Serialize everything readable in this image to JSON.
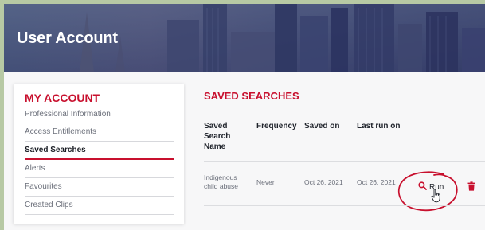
{
  "header": {
    "title": "User Account"
  },
  "sidebar": {
    "title": "MY ACCOUNT",
    "items": [
      {
        "label": "Professional Information",
        "active": false
      },
      {
        "label": "Access Entitlements",
        "active": false
      },
      {
        "label": "Saved Searches",
        "active": true
      },
      {
        "label": "Alerts",
        "active": false
      },
      {
        "label": "Favourites",
        "active": false
      },
      {
        "label": "Created Clips",
        "active": false
      }
    ]
  },
  "main": {
    "title": "SAVED SEARCHES",
    "columns": [
      "Saved\nSearch\nName",
      "Frequency",
      "Saved on",
      "Last run on"
    ],
    "rows": [
      {
        "name": "Indigenous\nchild abuse",
        "frequency": "Never",
        "saved_on": "Oct 26, 2021",
        "last_run_on": "Oct 26, 2021",
        "run_label": "Run"
      }
    ]
  },
  "icons": {
    "run": "search-icon",
    "delete": "trash-icon",
    "pointer": "hand-cursor-icon"
  },
  "colors": {
    "accent": "#c8102e",
    "text": "#1f232b",
    "muted": "#6b6f7a",
    "background": "#f7f7f8",
    "outer_border": "#b7c9a4"
  }
}
